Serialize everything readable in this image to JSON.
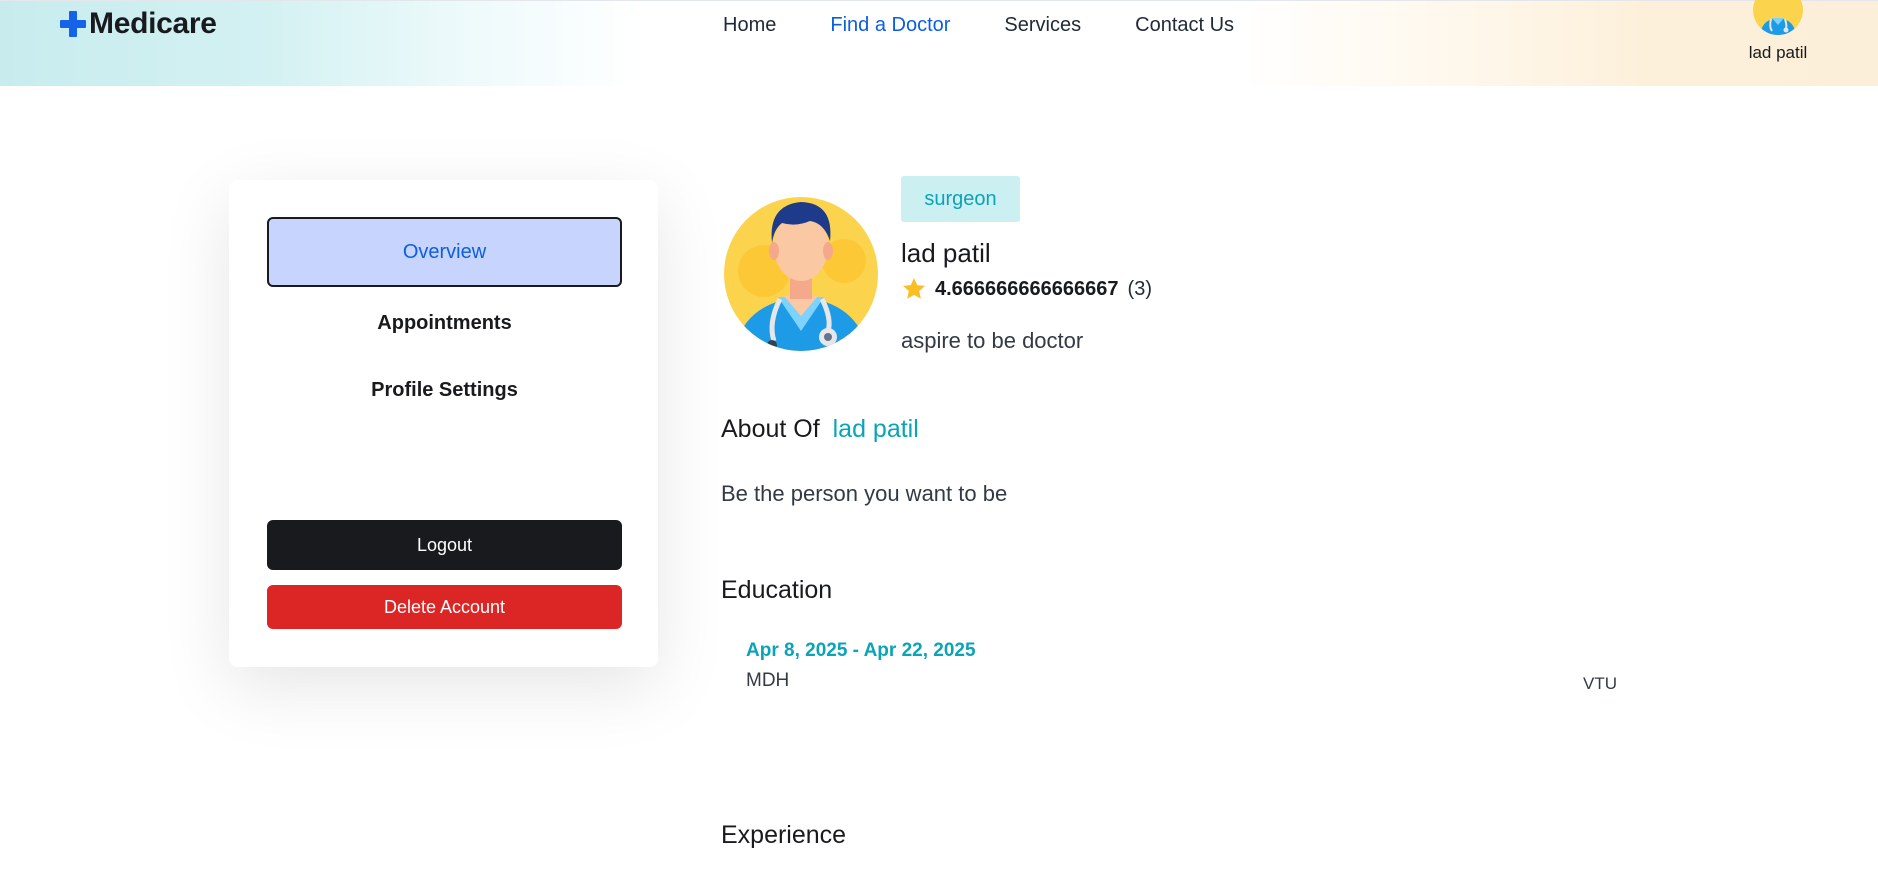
{
  "header": {
    "logo_text": "Medicare",
    "nav": [
      {
        "label": "Home"
      },
      {
        "label": "Find a Doctor",
        "active": true
      },
      {
        "label": "Services"
      },
      {
        "label": "Contact Us"
      }
    ],
    "user_name": "lad patil"
  },
  "sidebar": {
    "overview": "Overview",
    "appointments": "Appointments",
    "profile_settings": "Profile Settings",
    "logout": "Logout",
    "delete_account": "Delete Account"
  },
  "profile": {
    "specialization": "surgeon",
    "name": "lad patil",
    "rating": "4.666666666666667",
    "rating_count": "(3)",
    "bio": "aspire to be doctor"
  },
  "about": {
    "title_prefix": "About Of",
    "name": "lad patil",
    "text": "Be the person you want to be"
  },
  "education": {
    "title": "Education",
    "entries": [
      {
        "dates": "Apr 8, 2025 - Apr 22, 2025",
        "degree": "MDH",
        "university": "VTU"
      }
    ]
  },
  "experience": {
    "title": "Experience"
  },
  "colors": {
    "brand_blue": "#1463e8",
    "nav_active": "#0b5fe0",
    "accent_teal": "#0aa4b8",
    "badge_bg": "#cceff2",
    "overview_bg": "#c7d4fe",
    "logout_bg": "#181a1e",
    "delete_bg": "#dc2626",
    "star": "#fbbf24"
  },
  "icons": {
    "logo": "plus-cross-icon",
    "rating": "star-icon",
    "doctor_avatar": "doctor-avatar-icon"
  }
}
